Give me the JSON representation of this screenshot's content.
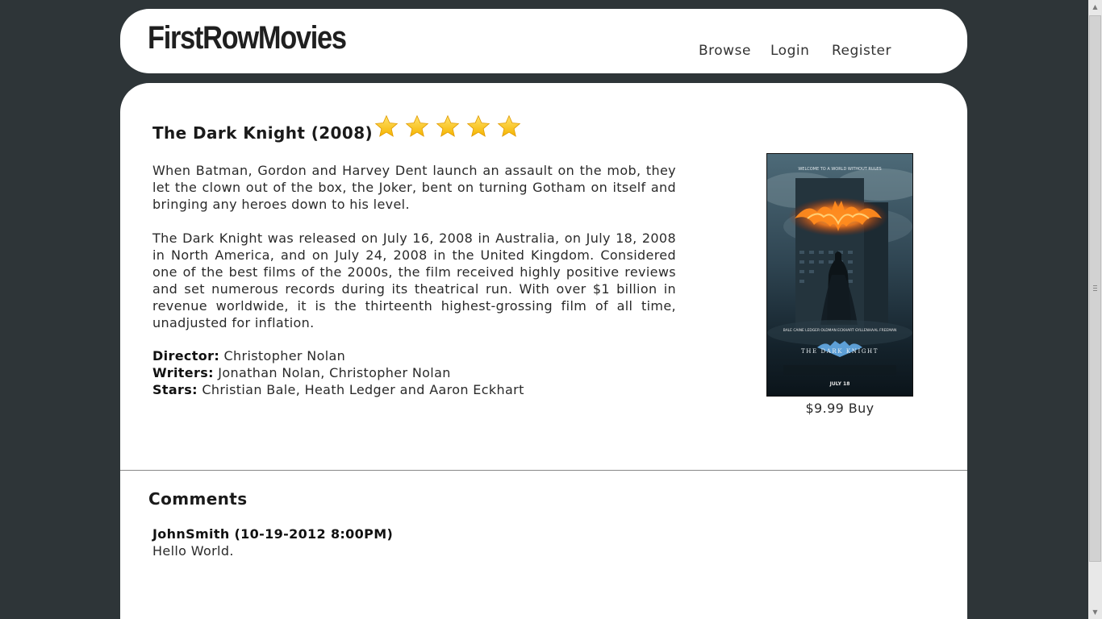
{
  "header": {
    "logo": "FirstRowMovies",
    "nav": [
      {
        "label": "Browse"
      },
      {
        "label": "Login"
      },
      {
        "label": "Register"
      }
    ]
  },
  "movie": {
    "title": "The Dark Knight (2008)",
    "rating": {
      "value": 5,
      "max": 5
    },
    "star_color": "#f5b400",
    "description_1": "When Batman, Gordon and Harvey Dent launch an assault on the mob, they let the clown out of the box, the Joker, bent on turning Gotham on itself and bringing any heroes down to his level.",
    "description_2": "The Dark Knight was released on July 16, 2008 in Australia, on July 18, 2008 in North America, and on July 24, 2008 in the United Kingdom. Considered one of the best films of the 2000s, the film received highly positive reviews and set numerous records during its theatrical run. With over $1 billion in revenue worldwide, it is the thirteenth highest-grossing film of all time, unadjusted for inflation.",
    "credits": {
      "director_label": "Director:",
      "director": "Christopher Nolan",
      "writers_label": "Writers:",
      "writers": "Jonathan Nolan, Christopher Nolan",
      "stars_label": "Stars:",
      "stars": "Christian Bale, Heath Ledger and Aaron Eckhart"
    },
    "poster": {
      "tagline": "WELCOME TO A WORLD WITHOUT RULES",
      "cast": "BALE  CAINE  LEDGER  OLDMAN  ECKHART  GYLLENHAAL  FREEMAN",
      "poster_title": "THE DARK KNIGHT",
      "date": "JULY 18"
    },
    "price": "$9.99",
    "buy_label": "Buy"
  },
  "comments": {
    "heading": "Comments",
    "items": [
      {
        "author_meta": "JohnSmith (10-19-2012 8:00PM)",
        "text": "Hello World."
      }
    ]
  }
}
